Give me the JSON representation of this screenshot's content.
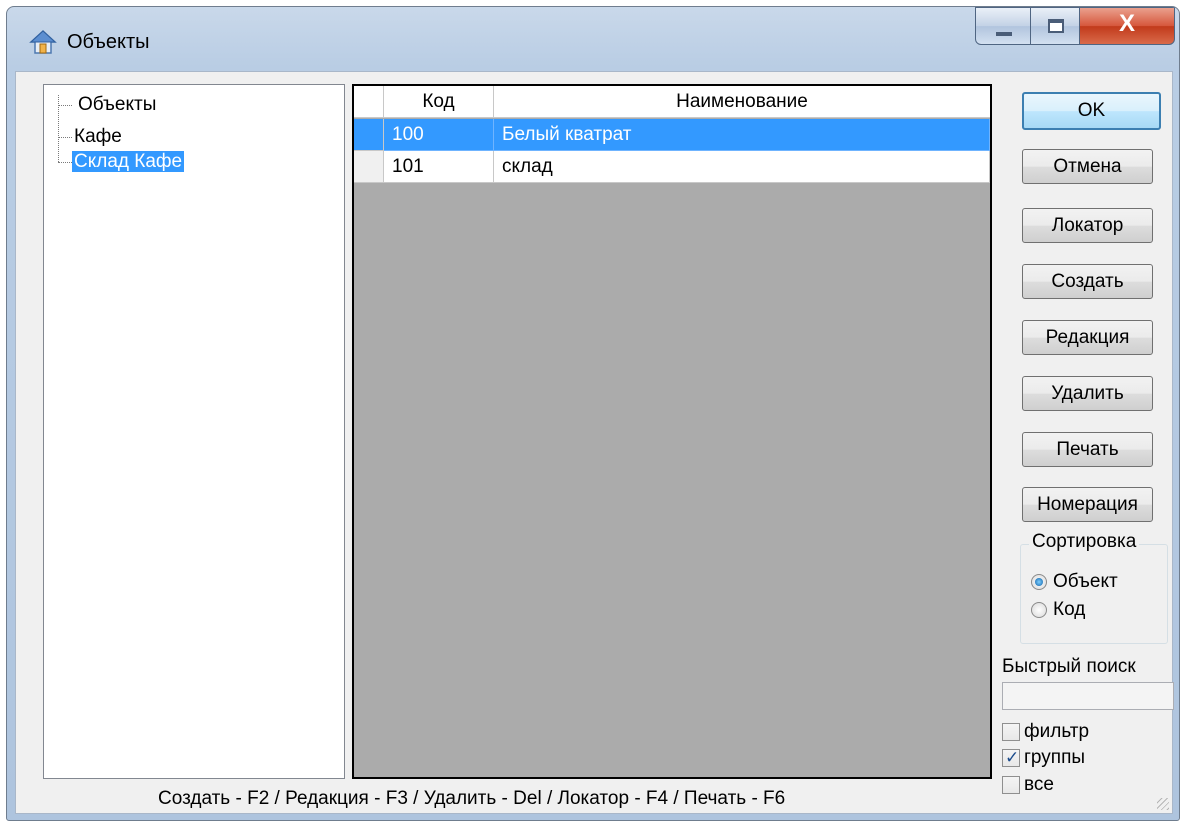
{
  "window": {
    "title": "Объекты",
    "icon": "house-icon",
    "controls": [
      "minimize-icon",
      "maximize-icon",
      "close-icon"
    ],
    "close_glyph": "X"
  },
  "tree": {
    "items": [
      {
        "label": "Объекты",
        "selected": false
      },
      {
        "label": "Кафе",
        "selected": false
      },
      {
        "label": "Склад Кафе",
        "selected": true
      }
    ]
  },
  "grid": {
    "columns": [
      "Код",
      "Наименование"
    ],
    "rows": [
      {
        "code": "100",
        "name": "Белый кватрат",
        "selected": true
      },
      {
        "code": "101",
        "name": "склад",
        "selected": false
      }
    ]
  },
  "buttons": {
    "ok": "OK",
    "cancel": "Отмена",
    "locator": "Локатор",
    "create": "Создать",
    "edit": "Редакция",
    "delete": "Удалить",
    "print": "Печать",
    "numbering": "Номерация"
  },
  "sort": {
    "legend": "Сортировка",
    "options": [
      {
        "label": "Объект",
        "selected": true
      },
      {
        "label": "Код",
        "selected": false
      }
    ]
  },
  "quick_search": {
    "label": "Быстрый поиск",
    "value": ""
  },
  "checks": [
    {
      "label": "фильтр",
      "checked": false
    },
    {
      "label": "группы",
      "checked": true
    },
    {
      "label": "все",
      "checked": false
    }
  ],
  "status_text": "Создать - F2 / Редакция - F3 / Удалить - Del / Локатор - F4 / Печать - F6",
  "colors": {
    "selection": "#3399ff",
    "grid_background": "#ababab",
    "dialog_background": "#f0f0f0",
    "close_button": "#c13a1b"
  }
}
